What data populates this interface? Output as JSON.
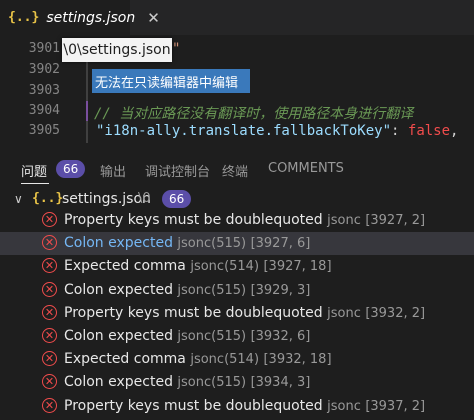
{
  "tab": {
    "icon": "{..}",
    "title": "settings.json",
    "close": "✕"
  },
  "editor": {
    "line_numbers": [
      "3901",
      "3902",
      "3903",
      "3904",
      "3905"
    ],
    "line1_code": "\"",
    "line4_comment": "// 当对应路径没有翻译时，使用路径本身进行翻译",
    "line5_key": "\"i18n-ally.translate.fallbackToKey\"",
    "line5_colon": ":",
    "line5_value": "false",
    "line5_comma": ",",
    "hover_path": "\\0\\settings.json",
    "readonly_message": "无法在只读编辑器中编辑"
  },
  "panel": {
    "tabs": [
      {
        "label": "问题",
        "badge": "66"
      },
      {
        "label": "输出"
      },
      {
        "label": "调试控制台"
      },
      {
        "label": "终端"
      },
      {
        "label": "COMMENTS"
      }
    ]
  },
  "group": {
    "chevron": "∨",
    "icon": "{..}",
    "file": "settings.json",
    "path": "\\0",
    "count": "66"
  },
  "problems": [
    {
      "message": "Property keys must be doublequoted",
      "source": "jsonc",
      "pos": "[3927, 2]"
    },
    {
      "message": "Colon expected",
      "source": "jsonc(515)",
      "pos": "[3927, 6]"
    },
    {
      "message": "Expected comma",
      "source": "jsonc(514)",
      "pos": "[3927, 18]"
    },
    {
      "message": "Colon expected",
      "source": "jsonc(515)",
      "pos": "[3929, 3]"
    },
    {
      "message": "Property keys must be doublequoted",
      "source": "jsonc",
      "pos": "[3932, 2]"
    },
    {
      "message": "Colon expected",
      "source": "jsonc(515)",
      "pos": "[3932, 6]"
    },
    {
      "message": "Expected comma",
      "source": "jsonc(514)",
      "pos": "[3932, 18]"
    },
    {
      "message": "Colon expected",
      "source": "jsonc(515)",
      "pos": "[3934, 3]"
    },
    {
      "message": "Property keys must be doublequoted",
      "source": "jsonc",
      "pos": "[3937, 2]"
    }
  ],
  "colors": {
    "error": "#f14c4c",
    "badge": "#5b4ea8",
    "string": "#ce9178",
    "key": "#9cdcfe",
    "keyword": "#569cd6",
    "comment": "#6a9955"
  }
}
